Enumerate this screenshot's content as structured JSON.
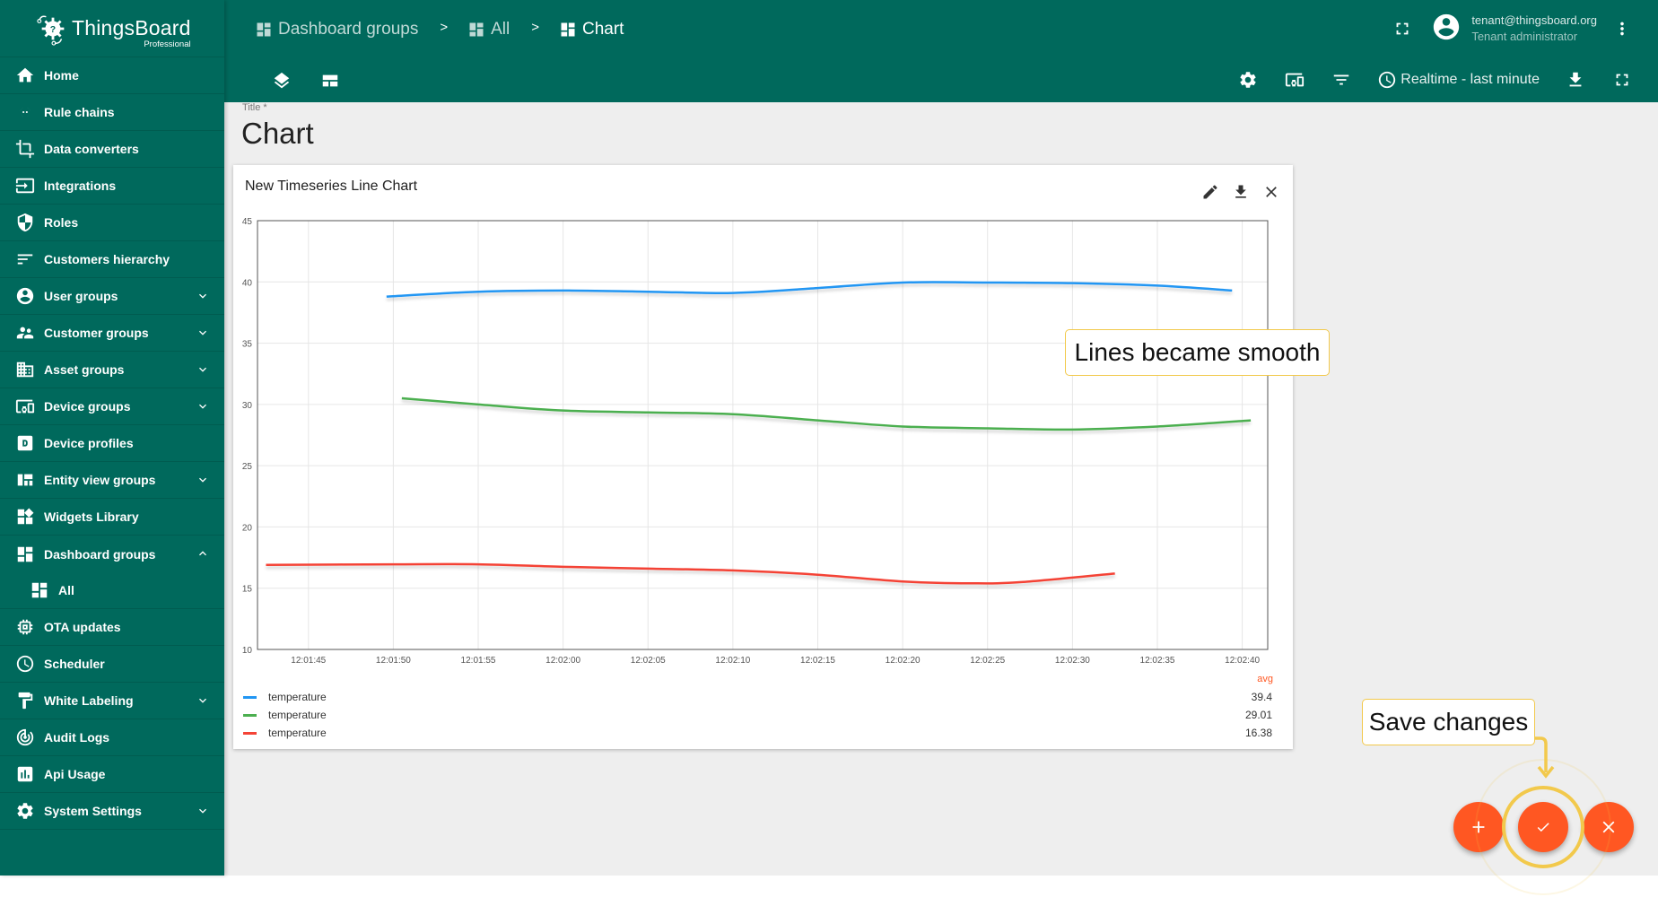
{
  "app": {
    "logo": {
      "name": "ThingsBoard",
      "edition": "Professional"
    }
  },
  "sidebar": {
    "items": [
      {
        "label": "Home",
        "icon": "home-icon",
        "expandable": false
      },
      {
        "label": "Rule chains",
        "icon": "rule-chains-icon",
        "expandable": false
      },
      {
        "label": "Data converters",
        "icon": "data-converters-icon",
        "expandable": false
      },
      {
        "label": "Integrations",
        "icon": "integrations-icon",
        "expandable": false
      },
      {
        "label": "Roles",
        "icon": "shield-icon",
        "expandable": false
      },
      {
        "label": "Customers hierarchy",
        "icon": "sort-icon",
        "expandable": false
      },
      {
        "label": "User groups",
        "icon": "account-circle-icon",
        "expandable": true
      },
      {
        "label": "Customer groups",
        "icon": "supervisor-icon",
        "expandable": true
      },
      {
        "label": "Asset groups",
        "icon": "domain-icon",
        "expandable": true
      },
      {
        "label": "Device groups",
        "icon": "devices-icon",
        "expandable": true
      },
      {
        "label": "Device profiles",
        "icon": "device-profile-icon",
        "expandable": false
      },
      {
        "label": "Entity view groups",
        "icon": "view-quilt-icon",
        "expandable": true
      },
      {
        "label": "Widgets Library",
        "icon": "widgets-icon",
        "expandable": false
      },
      {
        "label": "Dashboard groups",
        "icon": "dashboard-icon",
        "expandable": true,
        "expanded": true
      },
      {
        "label": "All",
        "icon": "dashboard-icon",
        "sub": true
      },
      {
        "label": "OTA updates",
        "icon": "memory-icon",
        "expandable": false
      },
      {
        "label": "Scheduler",
        "icon": "clock-icon",
        "expandable": false
      },
      {
        "label": "White Labeling",
        "icon": "format-paint-icon",
        "expandable": true
      },
      {
        "label": "Audit Logs",
        "icon": "track-changes-icon",
        "expandable": false
      },
      {
        "label": "Api Usage",
        "icon": "insert-chart-icon",
        "expandable": false
      },
      {
        "label": "System Settings",
        "icon": "gear-icon",
        "expandable": true
      }
    ]
  },
  "header": {
    "breadcrumbs": [
      {
        "label": "Dashboard groups",
        "icon": "dashboard-icon"
      },
      {
        "label": "All",
        "icon": "dashboard-icon"
      },
      {
        "label": "Chart",
        "icon": "dashboard-icon"
      }
    ],
    "separator": ">",
    "user": {
      "email": "tenant@thingsboard.org",
      "role": "Tenant administrator"
    },
    "timewindow": "Realtime - last minute"
  },
  "dashboard": {
    "title_label": "Title *",
    "title": "Chart"
  },
  "widget": {
    "title": "New Timeseries Line Chart",
    "legend": {
      "header": "avg",
      "rows": [
        {
          "label": "temperature",
          "color": "#2196f3",
          "avg": "39.4"
        },
        {
          "label": "temperature",
          "color": "#4caf50",
          "avg": "29.01"
        },
        {
          "label": "temperature",
          "color": "#f44336",
          "avg": "16.38"
        }
      ]
    }
  },
  "chart_data": {
    "type": "line",
    "title": "New Timeseries Line Chart",
    "xlabel": "",
    "ylabel": "",
    "x_type": "time",
    "xlim": [
      "12:01:42",
      "12:02:41.5"
    ],
    "ylim": [
      10,
      45
    ],
    "grid": true,
    "smooth": true,
    "x_ticks": [
      "12:01:45",
      "12:01:50",
      "12:01:55",
      "12:02:00",
      "12:02:05",
      "12:02:10",
      "12:02:15",
      "12:02:20",
      "12:02:25",
      "12:02:30",
      "12:02:35",
      "12:02:40"
    ],
    "y_ticks": [
      10,
      15,
      20,
      25,
      30,
      35,
      40,
      45
    ],
    "legend_position": "bottom",
    "series": [
      {
        "name": "temperature",
        "color": "#2196f3",
        "avg": 39.4,
        "points": [
          [
            "12:01:49.6",
            38.8
          ],
          [
            "12:01:55",
            39.2
          ],
          [
            "12:02:00",
            39.3
          ],
          [
            "12:02:05",
            39.2
          ],
          [
            "12:02:10",
            39.1
          ],
          [
            "12:02:15",
            39.5
          ],
          [
            "12:02:20",
            39.95
          ],
          [
            "12:02:25",
            39.95
          ],
          [
            "12:02:30",
            39.9
          ],
          [
            "12:02:35",
            39.7
          ],
          [
            "12:02:39.4",
            39.3
          ]
        ]
      },
      {
        "name": "temperature",
        "color": "#4caf50",
        "avg": 29.01,
        "points": [
          [
            "12:01:50.5",
            30.5
          ],
          [
            "12:01:55",
            30.0
          ],
          [
            "12:02:00",
            29.5
          ],
          [
            "12:02:05",
            29.35
          ],
          [
            "12:02:10",
            29.2
          ],
          [
            "12:02:15",
            28.7
          ],
          [
            "12:02:20",
            28.2
          ],
          [
            "12:02:25",
            28.05
          ],
          [
            "12:02:30",
            27.95
          ],
          [
            "12:02:35",
            28.2
          ],
          [
            "12:02:40.5",
            28.7
          ]
        ]
      },
      {
        "name": "temperature",
        "color": "#f44336",
        "avg": 16.38,
        "points": [
          [
            "12:01:42.5",
            16.9
          ],
          [
            "12:01:50",
            16.95
          ],
          [
            "12:01:55",
            16.95
          ],
          [
            "12:02:00",
            16.75
          ],
          [
            "12:02:05",
            16.6
          ],
          [
            "12:02:10",
            16.45
          ],
          [
            "12:02:15",
            16.1
          ],
          [
            "12:02:20",
            15.55
          ],
          [
            "12:02:24",
            15.4
          ],
          [
            "12:02:27",
            15.5
          ],
          [
            "12:02:32.5",
            16.2
          ]
        ]
      }
    ]
  },
  "annotations": {
    "smooth_note": "Lines became smooth",
    "save_note": "Save changes"
  },
  "fab": {
    "add": "add-widget",
    "save": "save-changes",
    "cancel": "cancel-edit"
  },
  "colors": {
    "primary": "#00695c",
    "accent": "#ff5722",
    "highlight": "#f2c94c",
    "background": "#eeeeee"
  }
}
